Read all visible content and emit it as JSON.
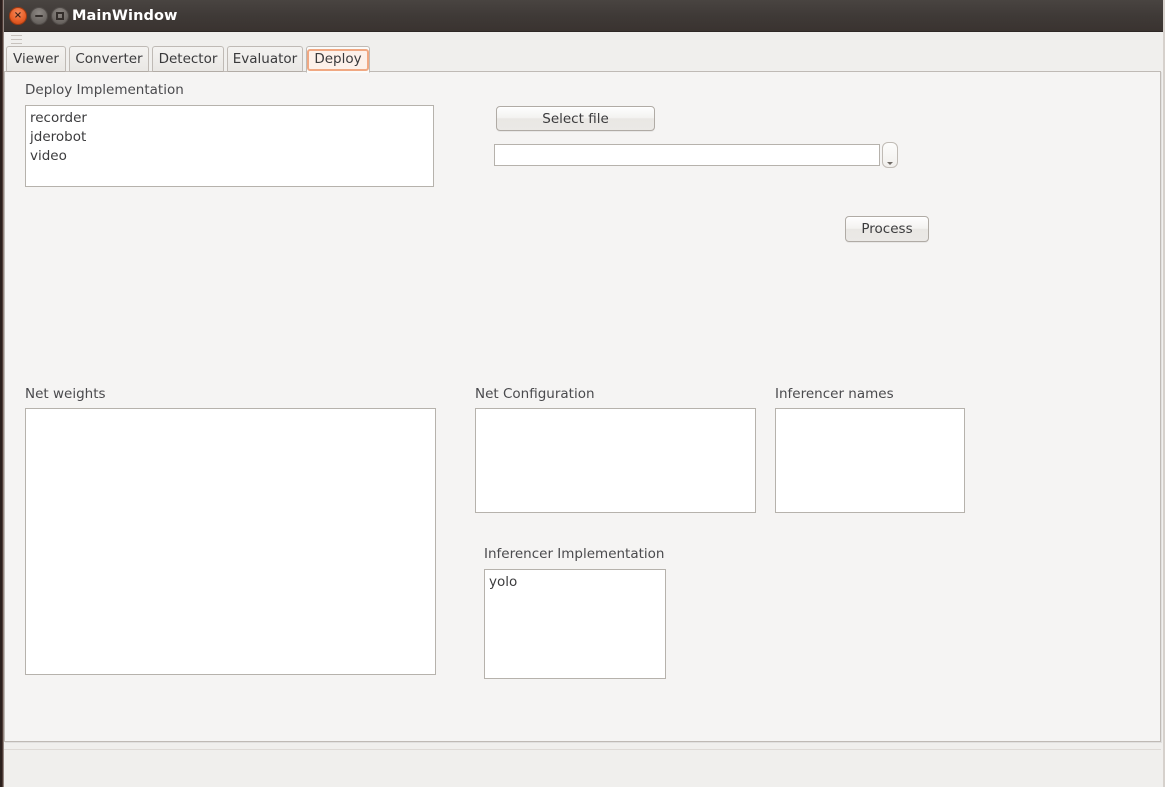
{
  "window": {
    "title": "MainWindow",
    "controls": [
      {
        "name": "close",
        "glyph": "×"
      },
      {
        "name": "minimize",
        "glyph": ""
      },
      {
        "name": "maximize",
        "glyph": ""
      }
    ]
  },
  "tabs": [
    {
      "label": "Viewer",
      "selected": false
    },
    {
      "label": "Converter",
      "selected": false
    },
    {
      "label": "Detector",
      "selected": false
    },
    {
      "label": "Evaluator",
      "selected": false
    },
    {
      "label": "Deploy",
      "selected": true
    }
  ],
  "deploy_tab": {
    "deploy_implementation": {
      "label": "Deploy Implementation",
      "items": [
        "recorder",
        "jderobot",
        "video"
      ]
    },
    "select_file_button": {
      "label": "Select file"
    },
    "file_path_field": {
      "value": "",
      "placeholder": ""
    },
    "file_path_dropdown": {
      "icon": "chevron-down-icon"
    },
    "process_button": {
      "label": "Process"
    },
    "net_weights": {
      "label": "Net weights",
      "items": []
    },
    "net_configuration": {
      "label": "Net Configuration",
      "items": []
    },
    "inferencer_names": {
      "label": "Inferencer names",
      "items": []
    },
    "inferencer_implementation": {
      "label": "Inferencer Implementation",
      "items": [
        "yolo"
      ]
    }
  },
  "statusbar": {
    "text": ""
  },
  "colors": {
    "window_chrome": "#3f3a37",
    "pane_background": "#f5f4f3",
    "window_background": "#f0efed",
    "accent_focus": "#f0a882",
    "close_button": "#e8612a",
    "field_border": "#b6b2ac",
    "text": "#3b3b3d"
  }
}
